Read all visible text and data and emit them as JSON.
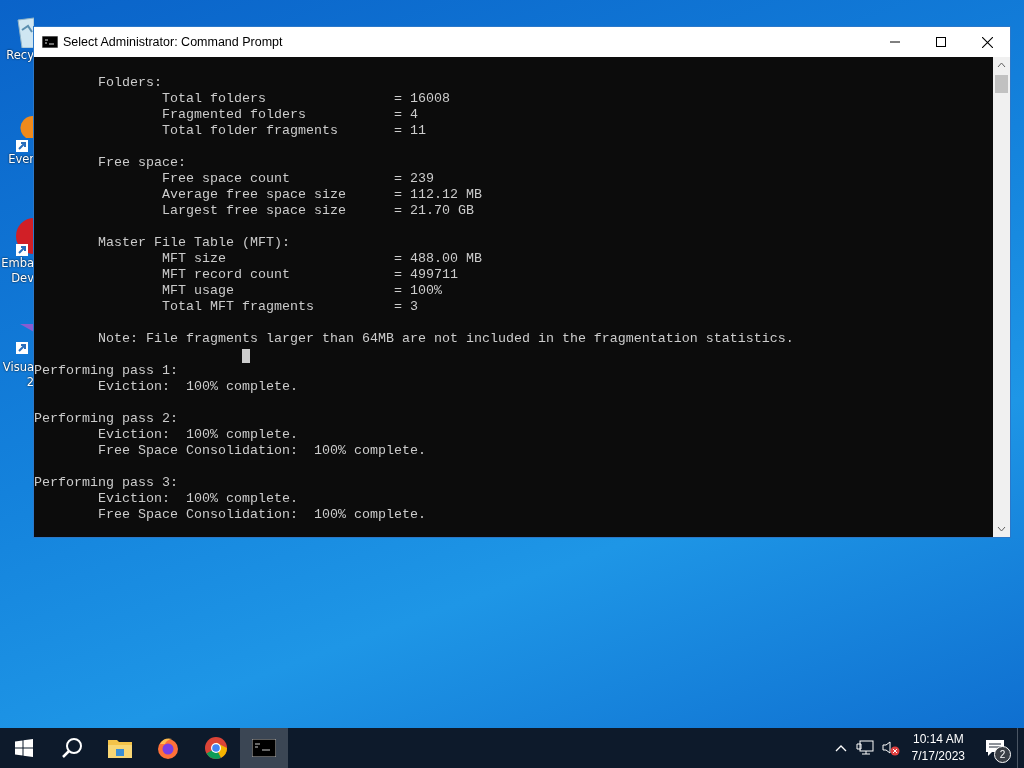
{
  "desktop_icons": [
    {
      "kind": "recycle",
      "label": [
        "Recy"
      ]
    },
    {
      "kind": "orange",
      "label": [
        "Ever"
      ]
    },
    {
      "kind": "red",
      "label": [
        "Emba",
        "Dev"
      ]
    },
    {
      "kind": "purple",
      "label": [
        "Visua",
        "2"
      ]
    }
  ],
  "window": {
    "title": "Select Administrator:  Command Prompt"
  },
  "console": {
    "blocks": [
      [
        "        Folders:",
        "                Total folders                = 16008",
        "                Fragmented folders           = 4",
        "                Total folder fragments       = 11"
      ],
      [
        "        Free space:",
        "                Free space count             = 239",
        "                Average free space size      = 112.12 MB",
        "                Largest free space size      = 21.70 GB"
      ],
      [
        "        Master File Table (MFT):",
        "                MFT size                     = 488.00 MB",
        "                MFT record count             = 499711",
        "                MFT usage                    = 100%",
        "                Total MFT fragments          = 3"
      ],
      [
        "        Note: File fragments larger than 64MB are not included in the fragmentation statistics."
      ],
      [
        "Performing pass 1:",
        "        Eviction:  100% complete."
      ],
      [
        "Performing pass 2:",
        "        Eviction:  100% complete.",
        "        Free Space Consolidation:  100% complete."
      ],
      [
        "Performing pass 3:",
        "        Eviction:  100% complete.",
        "        Free Space Consolidation:  100% complete."
      ]
    ]
  },
  "taskbar": {
    "apps": [
      {
        "kind": "search",
        "selected": false
      },
      {
        "kind": "folder",
        "selected": false
      },
      {
        "kind": "firefox",
        "selected": false
      },
      {
        "kind": "chrome",
        "selected": false
      },
      {
        "kind": "cmd",
        "selected": true
      }
    ],
    "time": "10:14 AM",
    "date": "7/17/2023",
    "notification_count": "2"
  }
}
